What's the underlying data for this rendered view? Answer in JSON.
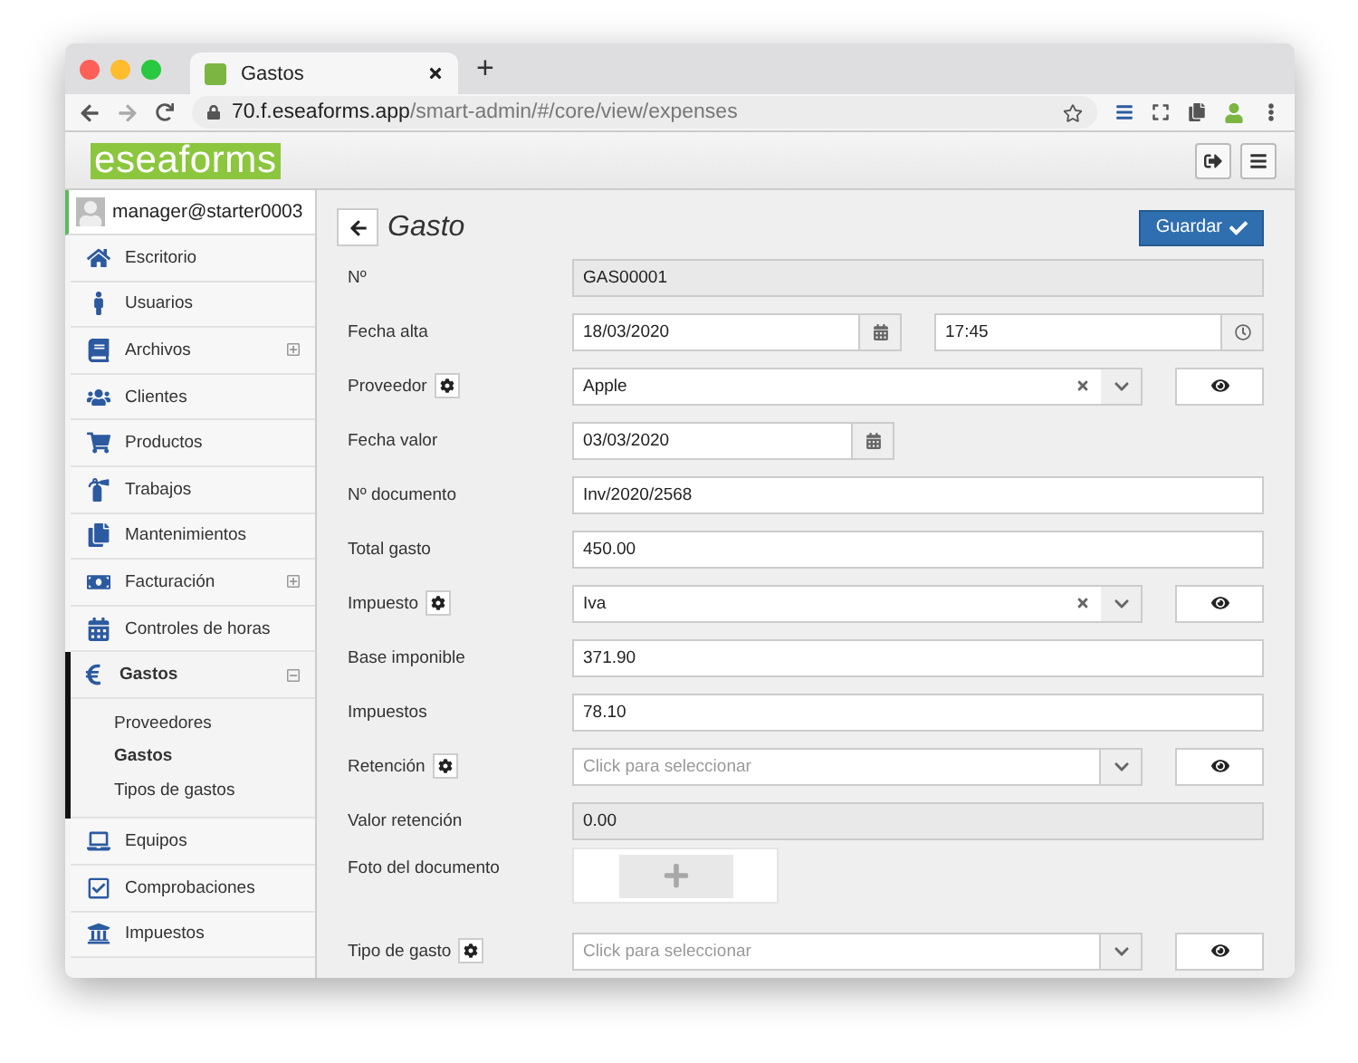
{
  "browser": {
    "tab_title": "Gastos",
    "new_tab": "+",
    "url_host": "70.f.eseaforms.app",
    "url_path": "/smart-admin/#/core/view/expenses"
  },
  "app": {
    "logo": "eseaforms"
  },
  "sidebar": {
    "user": "manager@starter0003",
    "items": [
      {
        "label": "Escritorio",
        "selected": false
      },
      {
        "label": "Usuarios",
        "selected": false
      },
      {
        "label": "Archivos",
        "selected": false,
        "expanded": false
      },
      {
        "label": "Clientes",
        "selected": false
      },
      {
        "label": "Productos",
        "selected": false
      },
      {
        "label": "Trabajos",
        "selected": false
      },
      {
        "label": "Mantenimientos",
        "selected": false
      },
      {
        "label": "Facturación",
        "selected": false,
        "expanded": false
      },
      {
        "label": "Controles de horas",
        "selected": false
      },
      {
        "label": "Gastos",
        "selected": true,
        "expanded": true,
        "children": [
          {
            "label": "Proveedores",
            "selected": false
          },
          {
            "label": "Gastos",
            "selected": true
          },
          {
            "label": "Tipos de gastos",
            "selected": false
          }
        ]
      },
      {
        "label": "Equipos",
        "selected": false
      },
      {
        "label": "Comprobaciones",
        "selected": false
      },
      {
        "label": "Impuestos",
        "selected": false
      }
    ]
  },
  "form": {
    "title": "Gasto",
    "save": "Guardar",
    "fields": [
      {
        "kind": "readonly",
        "label": "Nº",
        "value": "GAS00001"
      },
      {
        "kind": "datetime",
        "label": "Fecha alta",
        "date": "18/03/2020",
        "time": "17:45"
      },
      {
        "kind": "select",
        "label": "Proveedor",
        "value": "Apple"
      },
      {
        "kind": "date",
        "label": "Fecha valor",
        "value": "03/03/2020"
      },
      {
        "kind": "text",
        "label": "Nº documento",
        "value": "Inv/2020/2568"
      },
      {
        "kind": "text",
        "label": "Total gasto",
        "value": "450.00"
      },
      {
        "kind": "select",
        "label": "Impuesto",
        "value": "Iva"
      },
      {
        "kind": "text",
        "label": "Base imponible",
        "value": "371.90"
      },
      {
        "kind": "text",
        "label": "Impuestos",
        "value": "78.10"
      },
      {
        "kind": "select",
        "label": "Retención",
        "placeholder": "Click para seleccionar"
      },
      {
        "kind": "readonly",
        "label": "Valor retención",
        "value": "0.00"
      },
      {
        "kind": "upload",
        "label": "Foto del documento"
      },
      {
        "kind": "select",
        "label": "Tipo de gasto",
        "placeholder": "Click para seleccionar"
      }
    ]
  }
}
